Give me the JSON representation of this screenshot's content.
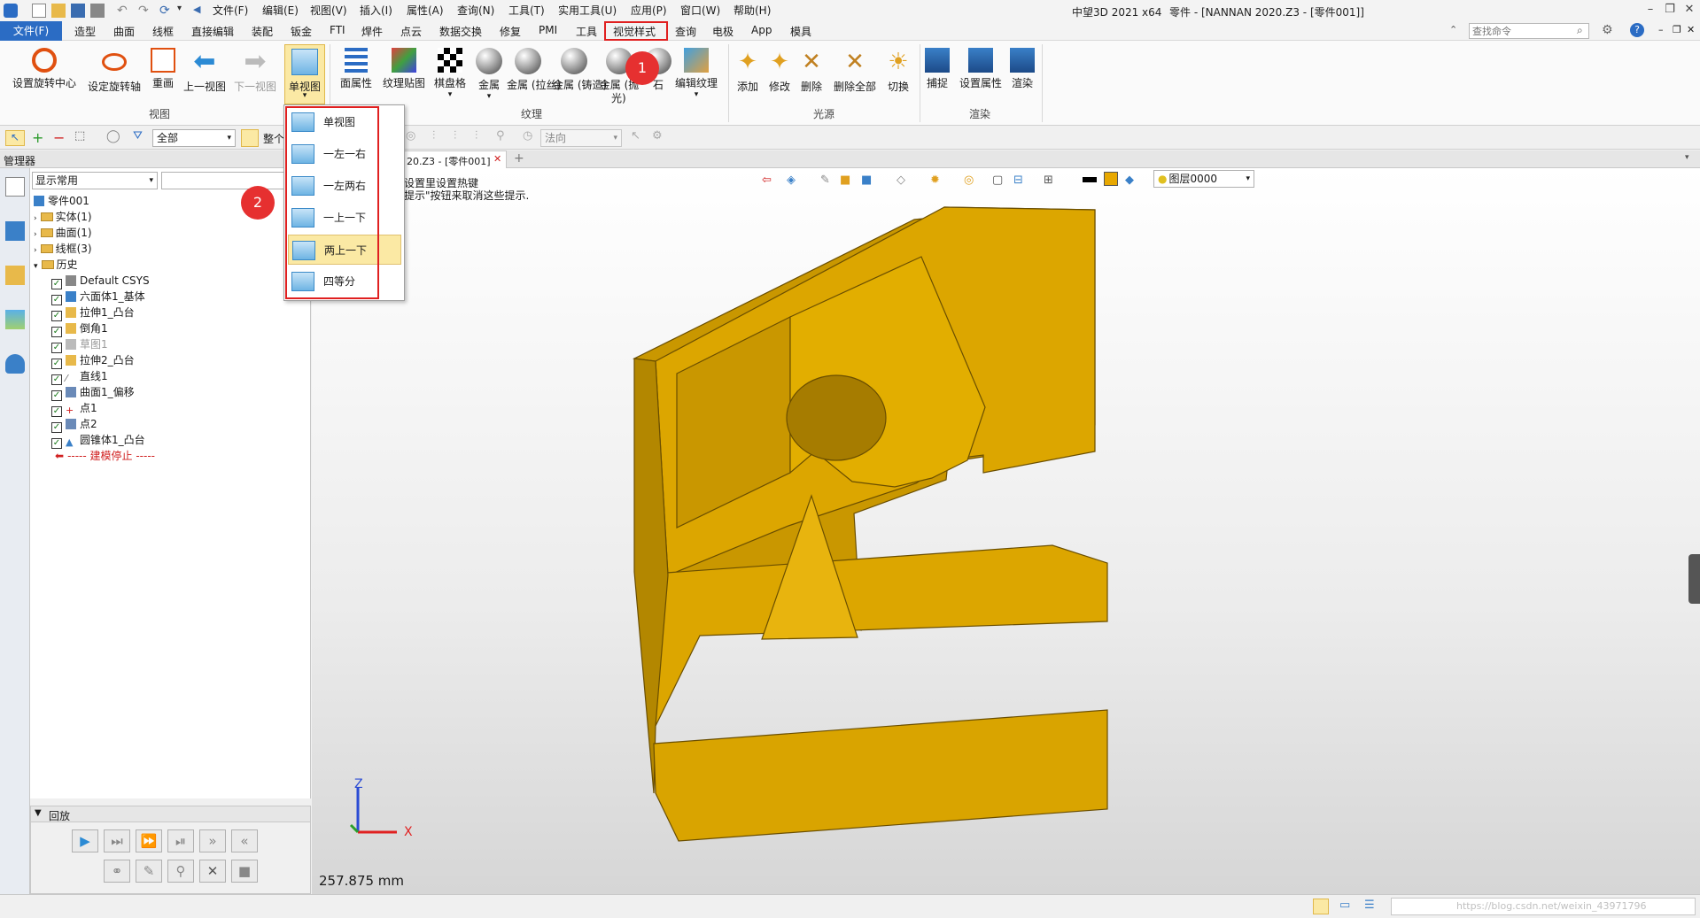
{
  "title": {
    "app": "中望3D 2021 x64",
    "doc": "零件 - [NANNAN 2020.Z3 - [零件001]]",
    "file_menu": "文件(F)",
    "menus": [
      "编辑(E)",
      "视图(V)",
      "插入(I)",
      "属性(A)",
      "查询(N)",
      "工具(T)",
      "实用工具(U)",
      "应用(P)",
      "窗口(W)",
      "帮助(H)"
    ]
  },
  "ribbon_tabs": {
    "file": "文件(F)",
    "items": [
      "造型",
      "曲面",
      "线框",
      "直接编辑",
      "装配",
      "钣金",
      "FTI",
      "焊件",
      "点云",
      "数据交换",
      "修复",
      "PMI",
      "工具",
      "视觉样式",
      "查询",
      "电极",
      "App",
      "模具"
    ],
    "active": "视觉样式",
    "search_placeholder": "查找命令"
  },
  "ribbon": {
    "view_group": {
      "label": "视图",
      "buttons": [
        "设置旋转中心",
        "设定旋转轴",
        "重画",
        "上一视图",
        "下一视图",
        "单视图"
      ]
    },
    "texture_group": {
      "label": "纹理",
      "buttons": [
        "面属性",
        "纹理贴图",
        "棋盘格",
        "金属",
        "金属 (拉丝)",
        "金属 (铸造)",
        "金属 (抛光)",
        "石",
        "编辑纹理"
      ],
      "metal_polish_line1": "金属 (抛",
      "metal_polish_line2": "光)"
    },
    "light_group": {
      "label": "光源",
      "buttons": [
        "添加",
        "修改",
        "删除",
        "删除全部",
        "切换"
      ]
    },
    "render_group": {
      "label": "渲染",
      "buttons": [
        "捕捉",
        "设置属性",
        "渲染"
      ]
    }
  },
  "toolbar2": {
    "filter_value": "全部",
    "scope_label": "整个",
    "direction_value": "法向"
  },
  "manager": {
    "title": "管理器",
    "filter_value": "显示常用",
    "root": "零件001",
    "folders": [
      "实体(1)",
      "曲面(1)",
      "线框(3)",
      "历史"
    ],
    "history": [
      "Default CSYS",
      "六面体1_基体",
      "拉伸1_凸台",
      "倒角1",
      "草图1",
      "拉伸2_凸台",
      "直线1",
      "曲面1_偏移",
      "点1",
      "点2",
      "圆锥体1_凸台"
    ],
    "stop_label": "----- 建模停止 -----"
  },
  "playback": {
    "title": "回放"
  },
  "viewport": {
    "tab_label": "20.Z3 - [零件001]",
    "hint_line1": "设置里设置热键",
    "hint_line2": "提示\"按钮来取消这些提示.",
    "layer_value": "图层0000",
    "scale_text": "257.875 mm",
    "axis_x": "X",
    "axis_z": "Z"
  },
  "dropdown": {
    "items": [
      "单视图",
      "一左一右",
      "一左两右",
      "一上一下",
      "两上一下",
      "四等分"
    ],
    "highlighted": "两上一下"
  },
  "annotations": {
    "badge1": "1",
    "badge2": "2"
  },
  "status": {
    "watermark": "https://blog.csdn.net/weixin_43971796"
  },
  "colors": {
    "part_face": "#dca600",
    "part_edge": "#6a4e00",
    "active_tab_outline": "#e02020",
    "badge": "#e63030",
    "file_tab": "#2b6cc4"
  }
}
